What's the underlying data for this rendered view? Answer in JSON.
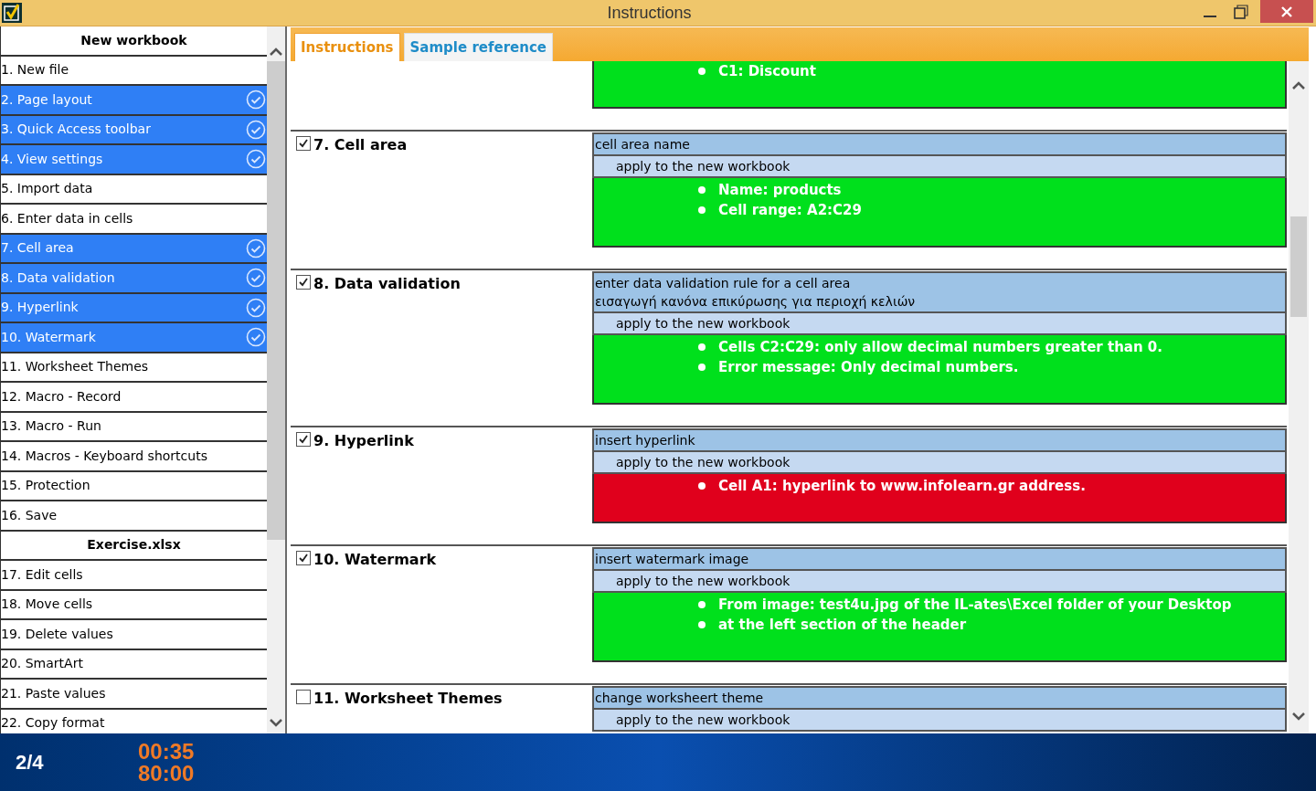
{
  "window": {
    "title": "Instructions"
  },
  "sidebar": {
    "items": [
      {
        "kind": "header",
        "label": "New workbook"
      },
      {
        "kind": "item",
        "label": "1. New file",
        "completed": false
      },
      {
        "kind": "item",
        "label": "2. Page layout",
        "completed": true
      },
      {
        "kind": "item",
        "label": "3. Quick Access toolbar",
        "completed": true
      },
      {
        "kind": "item",
        "label": "4. View settings",
        "completed": true
      },
      {
        "kind": "item",
        "label": "5. Import data",
        "completed": false
      },
      {
        "kind": "item",
        "label": "6. Enter data in cells",
        "completed": false
      },
      {
        "kind": "item",
        "label": "7. Cell area",
        "completed": true
      },
      {
        "kind": "item",
        "label": "8. Data validation",
        "completed": true
      },
      {
        "kind": "item",
        "label": "9. Hyperlink",
        "completed": true
      },
      {
        "kind": "item",
        "label": "10. Watermark",
        "completed": true
      },
      {
        "kind": "item",
        "label": "11. Worksheet Themes",
        "completed": false
      },
      {
        "kind": "item",
        "label": "12. Macro - Record",
        "completed": false
      },
      {
        "kind": "item",
        "label": "13. Macro - Run",
        "completed": false
      },
      {
        "kind": "item",
        "label": "14. Macros - Keyboard shortcuts",
        "completed": false
      },
      {
        "kind": "item",
        "label": "15. Protection",
        "completed": false
      },
      {
        "kind": "item",
        "label": "16. Save",
        "completed": false
      },
      {
        "kind": "header",
        "label": "Exercise.xlsx"
      },
      {
        "kind": "item",
        "label": "17. Edit cells",
        "completed": false
      },
      {
        "kind": "item",
        "label": "18. Move cells",
        "completed": false
      },
      {
        "kind": "item",
        "label": "19. Delete values",
        "completed": false
      },
      {
        "kind": "item",
        "label": "20. SmartArt",
        "completed": false
      },
      {
        "kind": "item",
        "label": "21. Paste values",
        "completed": false
      },
      {
        "kind": "item",
        "label": "22. Copy format",
        "completed": false
      }
    ]
  },
  "tabs": [
    {
      "label": "Instructions",
      "selected": true
    },
    {
      "label": "Sample reference",
      "selected": false
    }
  ],
  "sections": [
    {
      "result": {
        "color": "#00e01c",
        "bullets": [
          "C1: Discount"
        ]
      }
    },
    {
      "title": "7. Cell area",
      "checked": true,
      "rows": [
        {
          "kind": "task",
          "lines": [
            "cell area name"
          ]
        },
        {
          "kind": "apply",
          "lines": [
            "apply to the new workbook"
          ]
        }
      ],
      "result": {
        "color": "#00e01c",
        "bullets": [
          "Name: products",
          "Cell range: A2:C29"
        ]
      }
    },
    {
      "title": "8. Data validation",
      "checked": true,
      "rows": [
        {
          "kind": "task",
          "lines": [
            "enter data validation rule for a cell area",
            "εισαγωγή κανόνα επικύρωσης για περιοχή κελιών"
          ]
        },
        {
          "kind": "apply",
          "lines": [
            "apply to the new workbook"
          ]
        }
      ],
      "result": {
        "color": "#00e01c",
        "bullets": [
          "Cells C2:C29: only allow decimal numbers greater than 0.",
          "Error message: Only decimal numbers."
        ]
      }
    },
    {
      "title": "9. Hyperlink",
      "checked": true,
      "rows": [
        {
          "kind": "task",
          "lines": [
            "insert hyperlink"
          ]
        },
        {
          "kind": "apply",
          "lines": [
            "apply to the new workbook"
          ]
        }
      ],
      "result": {
        "color": "#e0001c",
        "bullets": [
          "Cell A1: hyperlink to www.infolearn.gr address."
        ]
      }
    },
    {
      "title": "10. Watermark",
      "checked": true,
      "rows": [
        {
          "kind": "task",
          "lines": [
            "insert watermark image"
          ]
        },
        {
          "kind": "apply",
          "lines": [
            "apply to the new workbook"
          ]
        }
      ],
      "result": {
        "color": "#00e01c",
        "bullets": [
          "From image: test4u.jpg of the IL-ates\\Excel folder of your Desktop",
          "at the left section of the header"
        ]
      }
    },
    {
      "title": "11. Worksheet Themes",
      "checked": false,
      "rows": [
        {
          "kind": "task",
          "lines": [
            "change worksheert theme"
          ]
        },
        {
          "kind": "apply",
          "lines": [
            "apply to the new workbook"
          ]
        }
      ]
    }
  ],
  "status_bar": {
    "progress": "2/4",
    "elapsed": "00:35",
    "limit": "80:00"
  }
}
